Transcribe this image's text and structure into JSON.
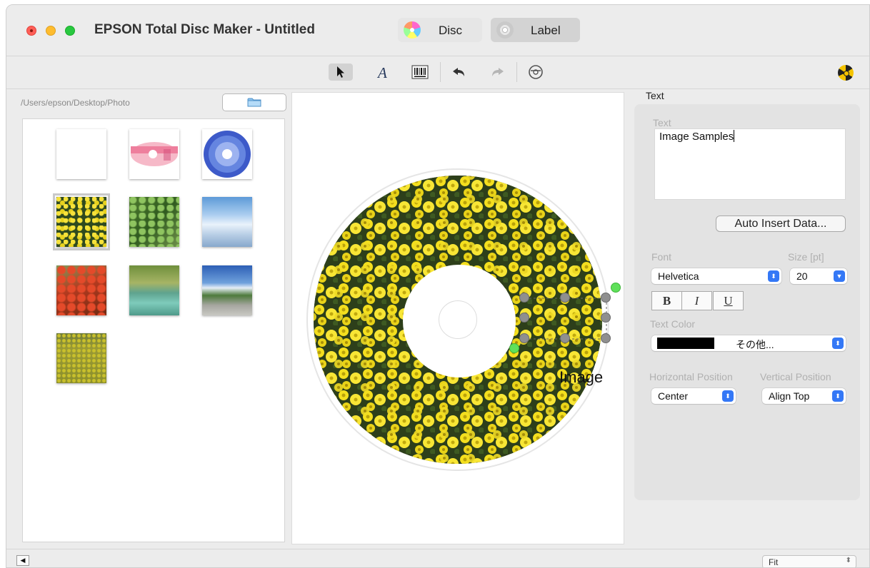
{
  "window": {
    "title": "EPSON Total Disc Maker - Untitled"
  },
  "mode_tabs": [
    {
      "label": "Disc",
      "selected": false
    },
    {
      "label": "Label",
      "selected": true
    }
  ],
  "toolbar": {
    "tools": [
      "select-arrow-icon",
      "text-tool-icon",
      "barcode-icon",
      "undo-icon",
      "redo-icon",
      "disc-view-icon"
    ],
    "selected_tool": "select-arrow-icon",
    "right_icon": "print-status-icon"
  },
  "browser": {
    "path": "/Users/epson/Desktop/Photo",
    "thumbnails": [
      {
        "name": "blank",
        "selected": false
      },
      {
        "name": "pink-disc-sample",
        "selected": false
      },
      {
        "name": "blue-disc-sample",
        "selected": false
      },
      {
        "name": "yellow-flowers",
        "selected": true
      },
      {
        "name": "green-moss",
        "selected": false
      },
      {
        "name": "sky-clouds",
        "selected": false
      },
      {
        "name": "autumn-red-leaves",
        "selected": false
      },
      {
        "name": "green-water",
        "selected": false
      },
      {
        "name": "mountains-sky",
        "selected": false
      },
      {
        "name": "yellow-field",
        "selected": false
      }
    ]
  },
  "canvas": {
    "selected_text": "Image"
  },
  "inspector": {
    "title": "Text",
    "text_label": "Text",
    "text_value": "Image Samples",
    "auto_insert_button": "Auto Insert Data...",
    "font_label": "Font",
    "font_value": "Helvetica",
    "size_label": "Size [pt]",
    "size_value": "20",
    "bold": "B",
    "italic": "I",
    "underline": "U",
    "color_label": "Text Color",
    "color_value": "その他...",
    "color_swatch": "#000000",
    "hpos_label": "Horizontal Position",
    "hpos_value": "Center",
    "vpos_label": "Vertical Position",
    "vpos_value": "Align Top"
  },
  "bottom": {
    "scroll_arrow": "◀",
    "zoom_value": "Fit"
  },
  "colors": {
    "accent": "#3478f6",
    "handle_gray": "#8f8f8f",
    "handle_green": "#5fe05a"
  }
}
